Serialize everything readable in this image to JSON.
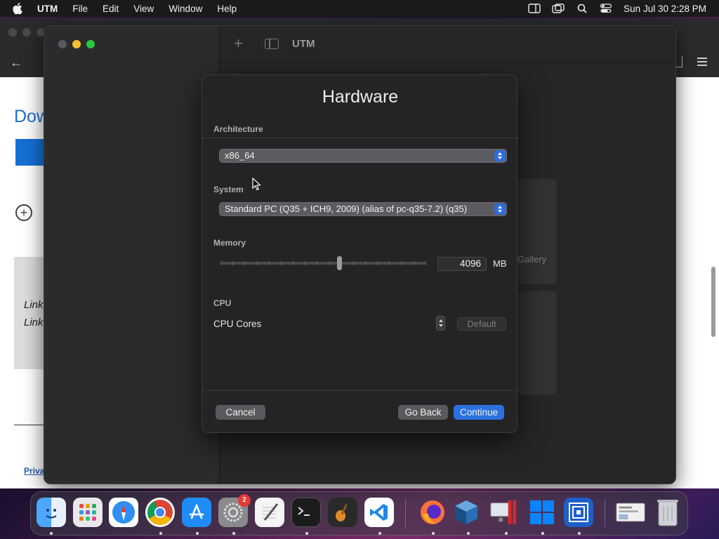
{
  "menubar": {
    "app_name": "UTM",
    "menus": [
      "File",
      "Edit",
      "View",
      "Window",
      "Help"
    ],
    "clock": "Sun Jul 30  2:28 PM",
    "status_icons": [
      "sidebar-icon",
      "screen-mirror-icon",
      "search-icon",
      "control-center-icon"
    ]
  },
  "browser": {
    "heading": "Dow",
    "link_lines": [
      "Link",
      "Link"
    ],
    "privacy_link": "Priva"
  },
  "utm_window": {
    "title": "UTM",
    "gallery_text": "Gallery"
  },
  "sheet": {
    "title": "Hardware",
    "architecture": {
      "label": "Architecture",
      "value": "x86_64"
    },
    "system": {
      "label": "System",
      "value": "Standard PC (Q35 + ICH9, 2009) (alias of pc-q35-7.2) (q35)"
    },
    "memory": {
      "label": "Memory",
      "value": "4096",
      "unit": "MB",
      "slider_fraction": 0.58
    },
    "cpu": {
      "label": "CPU",
      "cores_label": "CPU Cores",
      "default_placeholder": "Default"
    },
    "buttons": {
      "cancel": "Cancel",
      "go_back": "Go Back",
      "continue": "Continue"
    }
  },
  "dock": {
    "apps": [
      "Finder",
      "Launchpad",
      "Safari",
      "Chrome",
      "App Store",
      "System Settings",
      "TextEdit",
      "Terminal",
      "GarageBand",
      "VS Code",
      "Firefox",
      "VirtualBox",
      "Parallels",
      "Windows",
      "UTM",
      "Preview",
      "Trash"
    ],
    "settings_badge": "2"
  },
  "colors": {
    "accent": "#2b72e0",
    "sheet_bg": "#242426",
    "menubar_bg": "#1b1b1d"
  }
}
